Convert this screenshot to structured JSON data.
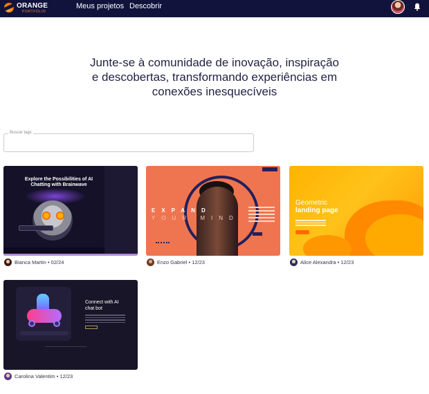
{
  "header": {
    "logo_title": "ORANGE",
    "logo_sub": "PORTFÓLIO",
    "nav": [
      "Meus projetos",
      "Descobrir"
    ]
  },
  "hero": {
    "lines": [
      "Junte-se à comunidade de inovação, inspiração",
      "e descobertas, transformando experiências em",
      "conexões inesquecíveis"
    ]
  },
  "search": {
    "label": "Buscar tags",
    "value": ""
  },
  "projects": [
    {
      "author": "Bianca Martin",
      "date": "02/24",
      "thumb_heading": "Explore the Possibilities of AI Chatting with Brainwave"
    },
    {
      "author": "Enzo Gabriel",
      "date": "12/23",
      "thumb_heading": "EXPAND",
      "thumb_sub": "YOUR MIND"
    },
    {
      "author": "Alice Alexandra",
      "date": "12/23",
      "thumb_heading": "Geometric",
      "thumb_sub": "landing page"
    },
    {
      "author": "Carolina Valentim",
      "date": "12/23",
      "thumb_heading": "Connect with AI chat bot"
    }
  ],
  "colors": {
    "header_bg": "#11133c",
    "accent": "#ff8a3d",
    "text": "#222244"
  }
}
